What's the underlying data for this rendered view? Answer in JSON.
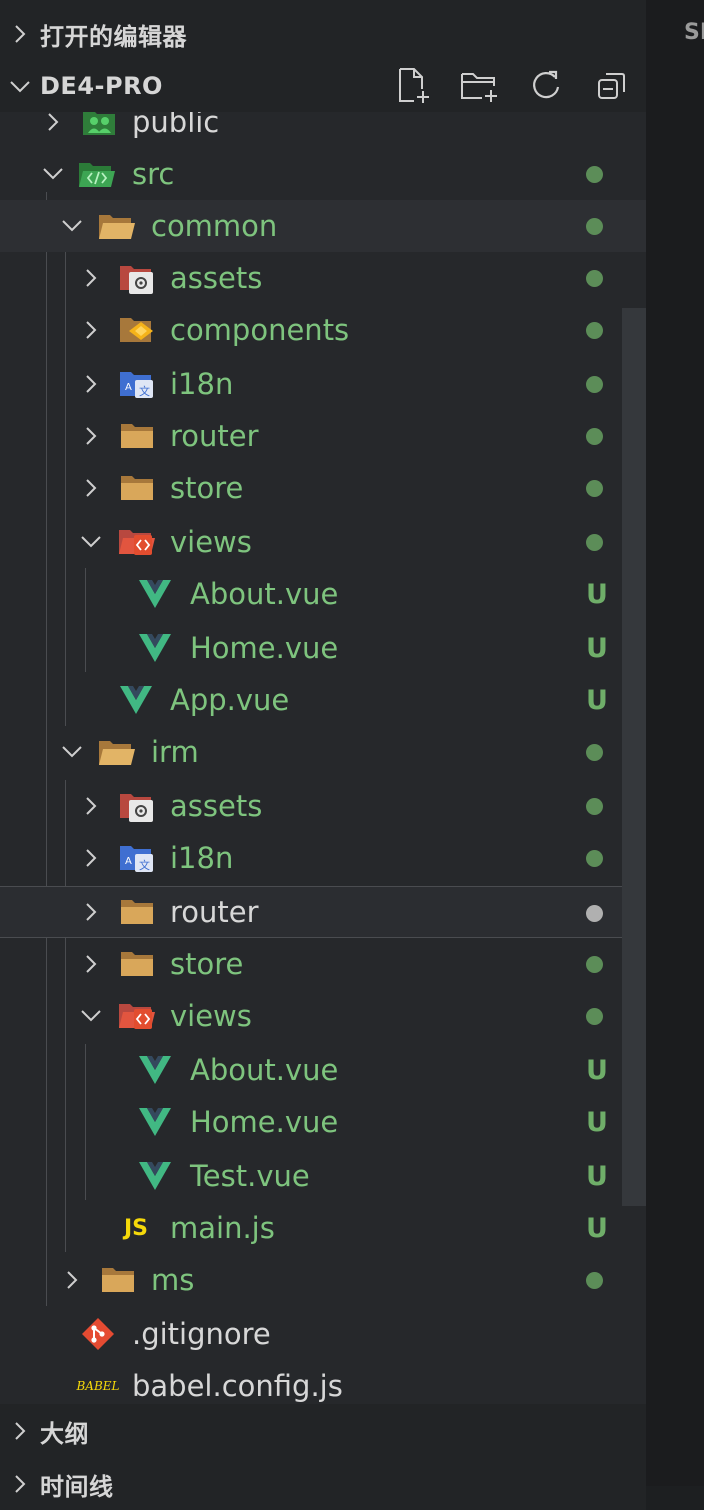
{
  "sections": {
    "open_editors": "打开的编辑器",
    "project": "DE4-PRO",
    "outline": "大纲",
    "timeline": "时间线"
  },
  "right_clip": "SI",
  "tree": [
    {
      "label": "public",
      "status": "",
      "color": "white"
    },
    {
      "label": "src",
      "status": "dot",
      "color": "green"
    },
    {
      "label": "common",
      "status": "dot",
      "color": "green"
    },
    {
      "label": "assets",
      "status": "dot",
      "color": "green"
    },
    {
      "label": "components",
      "status": "dot",
      "color": "green"
    },
    {
      "label": "i18n",
      "status": "dot",
      "color": "green"
    },
    {
      "label": "router",
      "status": "dot",
      "color": "green"
    },
    {
      "label": "store",
      "status": "dot",
      "color": "green"
    },
    {
      "label": "views",
      "status": "dot",
      "color": "green"
    },
    {
      "label": "About.vue",
      "status": "U",
      "color": "green"
    },
    {
      "label": "Home.vue",
      "status": "U",
      "color": "green"
    },
    {
      "label": "App.vue",
      "status": "U",
      "color": "green"
    },
    {
      "label": "irm",
      "status": "dot",
      "color": "green"
    },
    {
      "label": "assets",
      "status": "dot",
      "color": "green"
    },
    {
      "label": "i18n",
      "status": "dot",
      "color": "green"
    },
    {
      "label": "router",
      "status": "dot",
      "color": "white"
    },
    {
      "label": "store",
      "status": "dot",
      "color": "green"
    },
    {
      "label": "views",
      "status": "dot",
      "color": "green"
    },
    {
      "label": "About.vue",
      "status": "U",
      "color": "green"
    },
    {
      "label": "Home.vue",
      "status": "U",
      "color": "green"
    },
    {
      "label": "Test.vue",
      "status": "U",
      "color": "green"
    },
    {
      "label": "main.js",
      "status": "U",
      "color": "green"
    },
    {
      "label": "ms",
      "status": "dot",
      "color": "green"
    },
    {
      "label": ".gitignore",
      "status": "",
      "color": "white"
    },
    {
      "label": "babel.config.js",
      "status": "",
      "color": "white"
    }
  ],
  "icons": {
    "js_glyph": "JS",
    "babel_glyph": "BABEL"
  },
  "colors": {
    "modified_green": "#7ec47e",
    "untracked_badge": "#6fae69",
    "folder": "#d9a75a"
  }
}
